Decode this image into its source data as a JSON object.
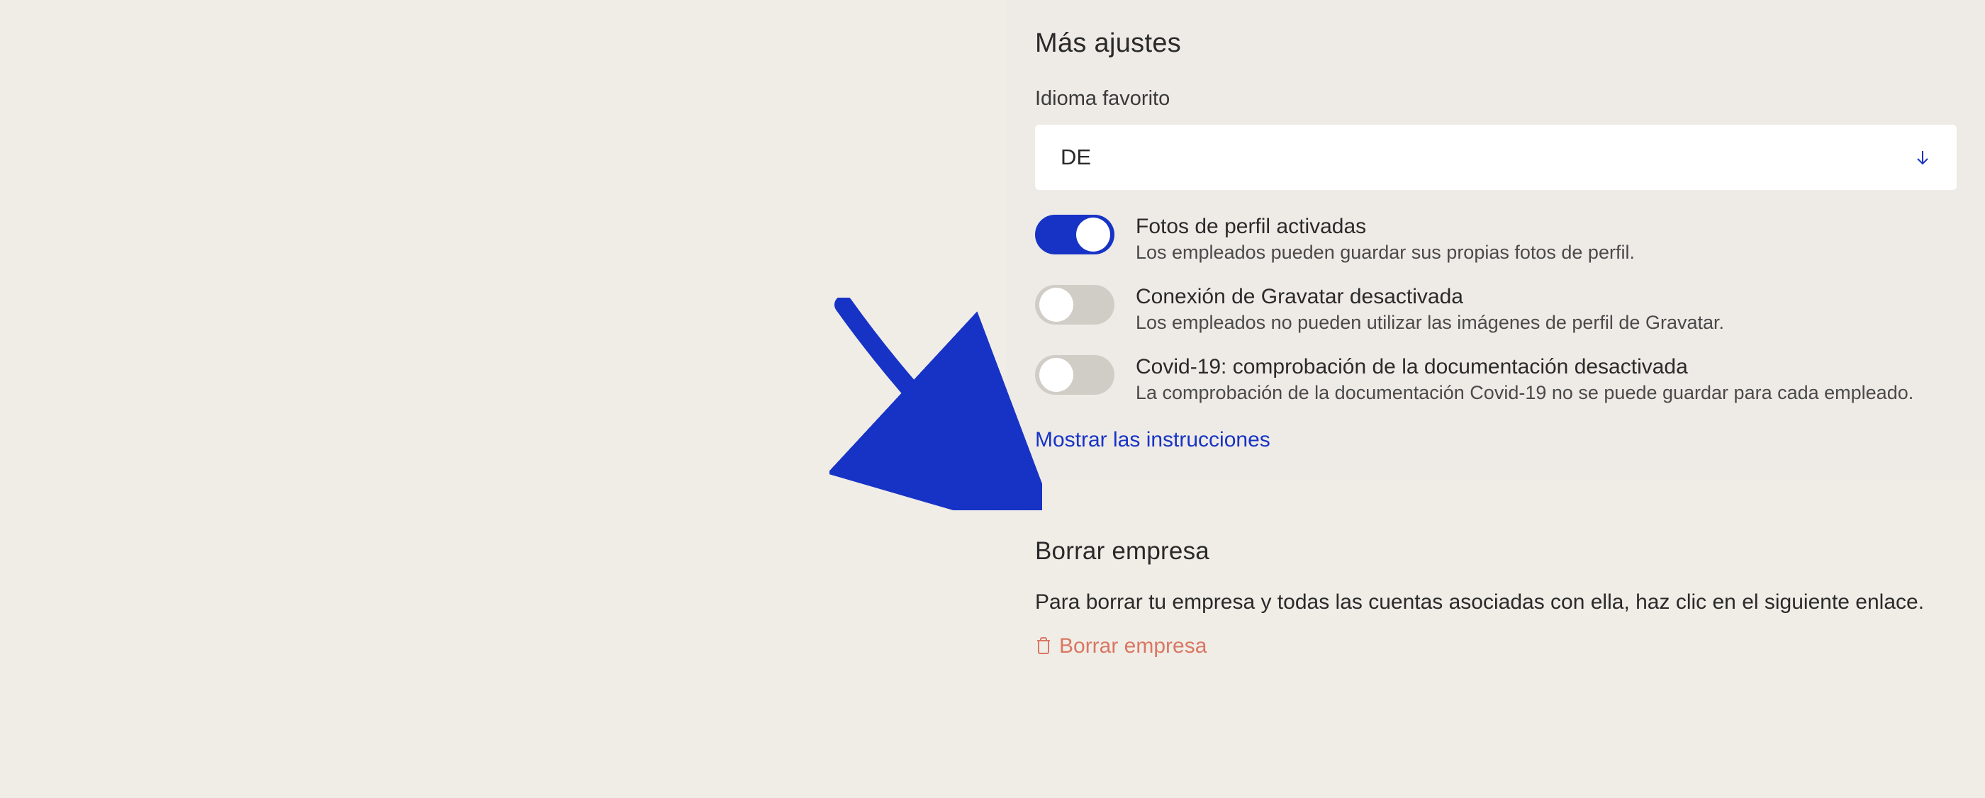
{
  "moreSettings": {
    "title": "Más ajustes",
    "languageLabel": "Idioma favorito",
    "languageValue": "DE",
    "toggles": [
      {
        "on": true,
        "title": "Fotos de perfil activadas",
        "desc": "Los empleados pueden guardar sus propias fotos de perfil."
      },
      {
        "on": false,
        "title": "Conexión de Gravatar desactivada",
        "desc": "Los empleados no pueden utilizar las imágenes de perfil de Gravatar."
      },
      {
        "on": false,
        "title": "Covid-19: comprobación de la documentación desactivada",
        "desc": "La comprobación de la documentación Covid-19 no se puede guardar para cada empleado."
      }
    ],
    "instructionsLink": "Mostrar las instrucciones"
  },
  "deleteCompany": {
    "title": "Borrar empresa",
    "body": "Para borrar tu empresa y todas las cuentas asociadas con ella, haz clic en el siguiente enlace.",
    "linkText": "Borrar empresa"
  }
}
